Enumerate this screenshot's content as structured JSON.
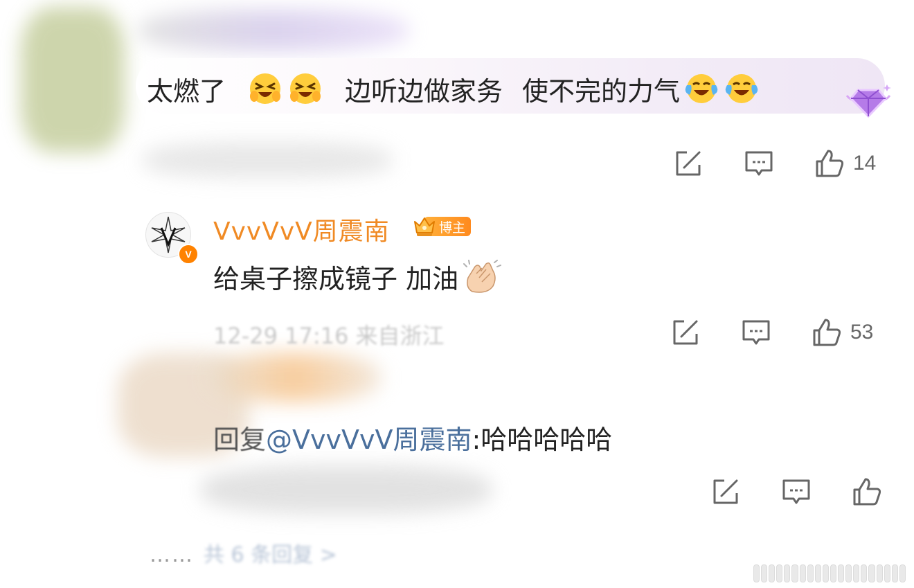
{
  "comment1": {
    "text_a": "太燃了",
    "emoji_a": "laughing-squint-face",
    "text_b": "边听边做家务",
    "text_c": "使不完的力气",
    "emoji_b": "tears-of-joy-face",
    "level_badge": "purple-diamond-badge",
    "actions": {
      "share_icon": "share-icon",
      "comment_icon": "comment-icon",
      "like_icon": "thumbs-up-icon",
      "likes": "14"
    }
  },
  "comment2": {
    "username": "VvvVvV周震南",
    "role_badge": "博主",
    "verified_badge": "V",
    "text": "给桌子擦成镜子 加油",
    "emoji": "clapping-hands",
    "meta": "12-29 17:16 来自浙江",
    "actions": {
      "share_icon": "share-icon",
      "comment_icon": "comment-icon",
      "like_icon": "thumbs-up-icon",
      "likes": "53"
    }
  },
  "comment3": {
    "reply_prefix": "回复",
    "mention": "@VvvVvV周震南",
    "text": ":哈哈哈哈哈",
    "actions": {
      "share_icon": "share-icon",
      "comment_icon": "comment-icon",
      "like_icon": "thumbs-up-icon"
    }
  },
  "more_replies": {
    "dots": "……",
    "label": "共 6 条回复 >"
  },
  "colors": {
    "username": "#f08a24",
    "mention": "#4a6f9c",
    "count": "#666666",
    "icon": "#666666"
  }
}
